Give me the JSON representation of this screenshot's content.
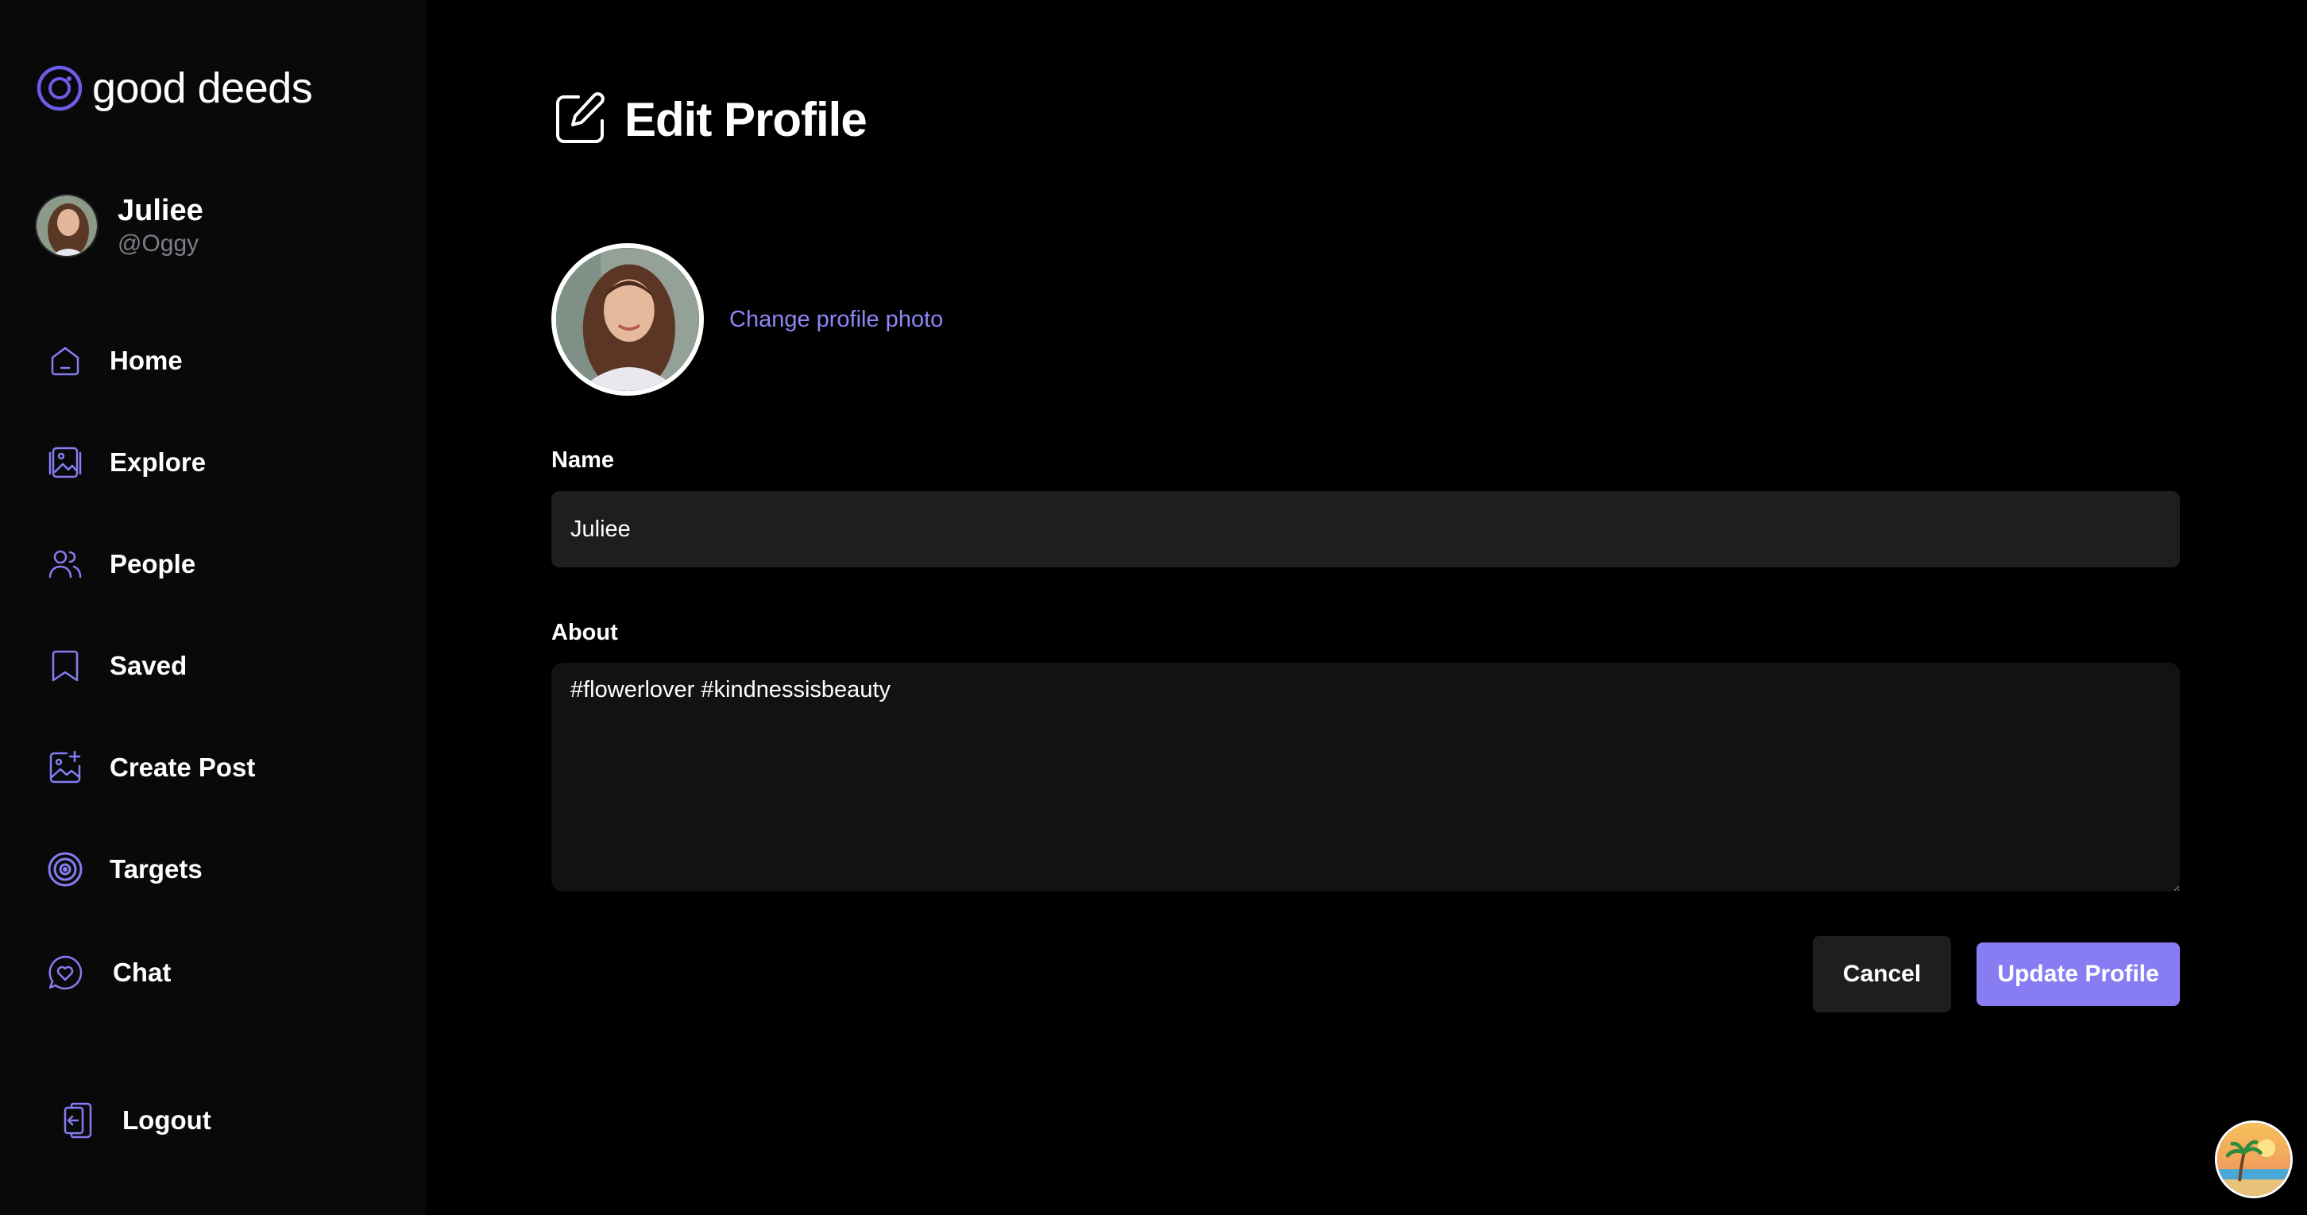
{
  "app": {
    "name": "good deeds"
  },
  "user": {
    "name": "Juliee",
    "handle": "@Oggy"
  },
  "nav": [
    {
      "label": "Home",
      "icon": "home-icon"
    },
    {
      "label": "Explore",
      "icon": "gallery-icon"
    },
    {
      "label": "People",
      "icon": "people-icon"
    },
    {
      "label": "Saved",
      "icon": "bookmark-icon"
    },
    {
      "label": "Create Post",
      "icon": "image-add-icon"
    },
    {
      "label": "Targets",
      "icon": "target-icon"
    },
    {
      "label": "Chat",
      "icon": "chat-heart-icon"
    }
  ],
  "logout": {
    "label": "Logout",
    "icon": "logout-icon"
  },
  "page": {
    "title": "Edit Profile",
    "change_photo": "Change profile photo",
    "name_label": "Name",
    "name_value": "Juliee",
    "about_label": "About",
    "about_value": "#flowerlover #kindnessisbeauty",
    "cancel_label": "Cancel",
    "update_label": "Update Profile"
  },
  "colors": {
    "accent": "#877cf2",
    "link": "#8f86f5",
    "sidebar_bg": "#09090a",
    "input_bg": "#1e1e20"
  }
}
